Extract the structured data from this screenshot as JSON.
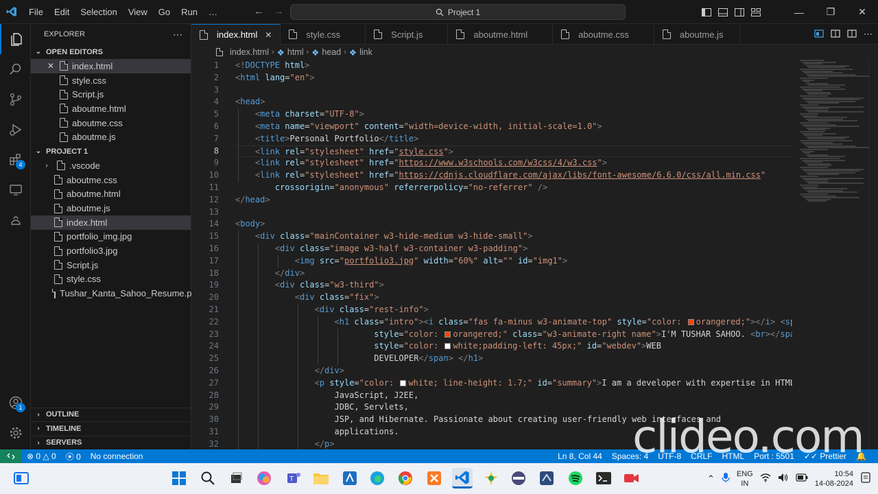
{
  "titlebar": {
    "menu": [
      "File",
      "Edit",
      "Selection",
      "View",
      "Go",
      "Run",
      "…"
    ],
    "search_text": "Project 1"
  },
  "sidebar": {
    "header": "EXPLORER",
    "open_editors_title": "OPEN EDITORS",
    "open_editors": [
      "index.html",
      "style.css",
      "Script.js",
      "aboutme.html",
      "aboutme.css",
      "aboutme.js"
    ],
    "project_title": "PROJECT 1",
    "project_items": [
      ".vscode",
      "aboutme.css",
      "aboutme.html",
      "aboutme.js",
      "index.html",
      "portfolio_img.jpg",
      "portfolio3.jpg",
      "Script.js",
      "style.css",
      "Tushar_Kanta_Sahoo_Resume.pdf"
    ],
    "outline_title": "OUTLINE",
    "timeline_title": "TIMELINE",
    "servers_title": "SERVERS"
  },
  "activity": {
    "extensions_badge": "4",
    "accounts_badge": "1"
  },
  "tabs": [
    "index.html",
    "style.css",
    "Script.js",
    "aboutme.html",
    "aboutme.css",
    "aboutme.js"
  ],
  "breadcrumb": [
    "index.html",
    "html",
    "head",
    "link"
  ],
  "editor": {
    "line_numbers": [
      "1",
      "2",
      "3",
      "4",
      "5",
      "6",
      "7",
      "8",
      "9",
      "10",
      "11",
      "12",
      "13",
      "14",
      "15",
      "16",
      "17",
      "18",
      "19",
      "20",
      "21",
      "22",
      "23",
      "24",
      "25",
      "26",
      "27",
      "28",
      "29",
      "30",
      "31",
      "32"
    ],
    "current_line": 8
  },
  "statusbar": {
    "errors": "0",
    "warnings": "0",
    "info": "0",
    "connection": "No connection",
    "position": "Ln 8, Col 44",
    "spaces": "Spaces: 4",
    "encoding": "UTF-8",
    "eol": "CRLF",
    "language": "HTML",
    "port": "Port : 5501",
    "prettier": "Prettier"
  },
  "watermark": "clideo.com",
  "taskbar": {
    "lang_top": "ENG",
    "lang_bottom": "IN",
    "time": "10:54",
    "date": "14-08-2024"
  },
  "colors": {
    "accent": "#0078d4",
    "statusbar": "#0078d4",
    "remote": "#16825d",
    "orangered": "#ff4500"
  }
}
